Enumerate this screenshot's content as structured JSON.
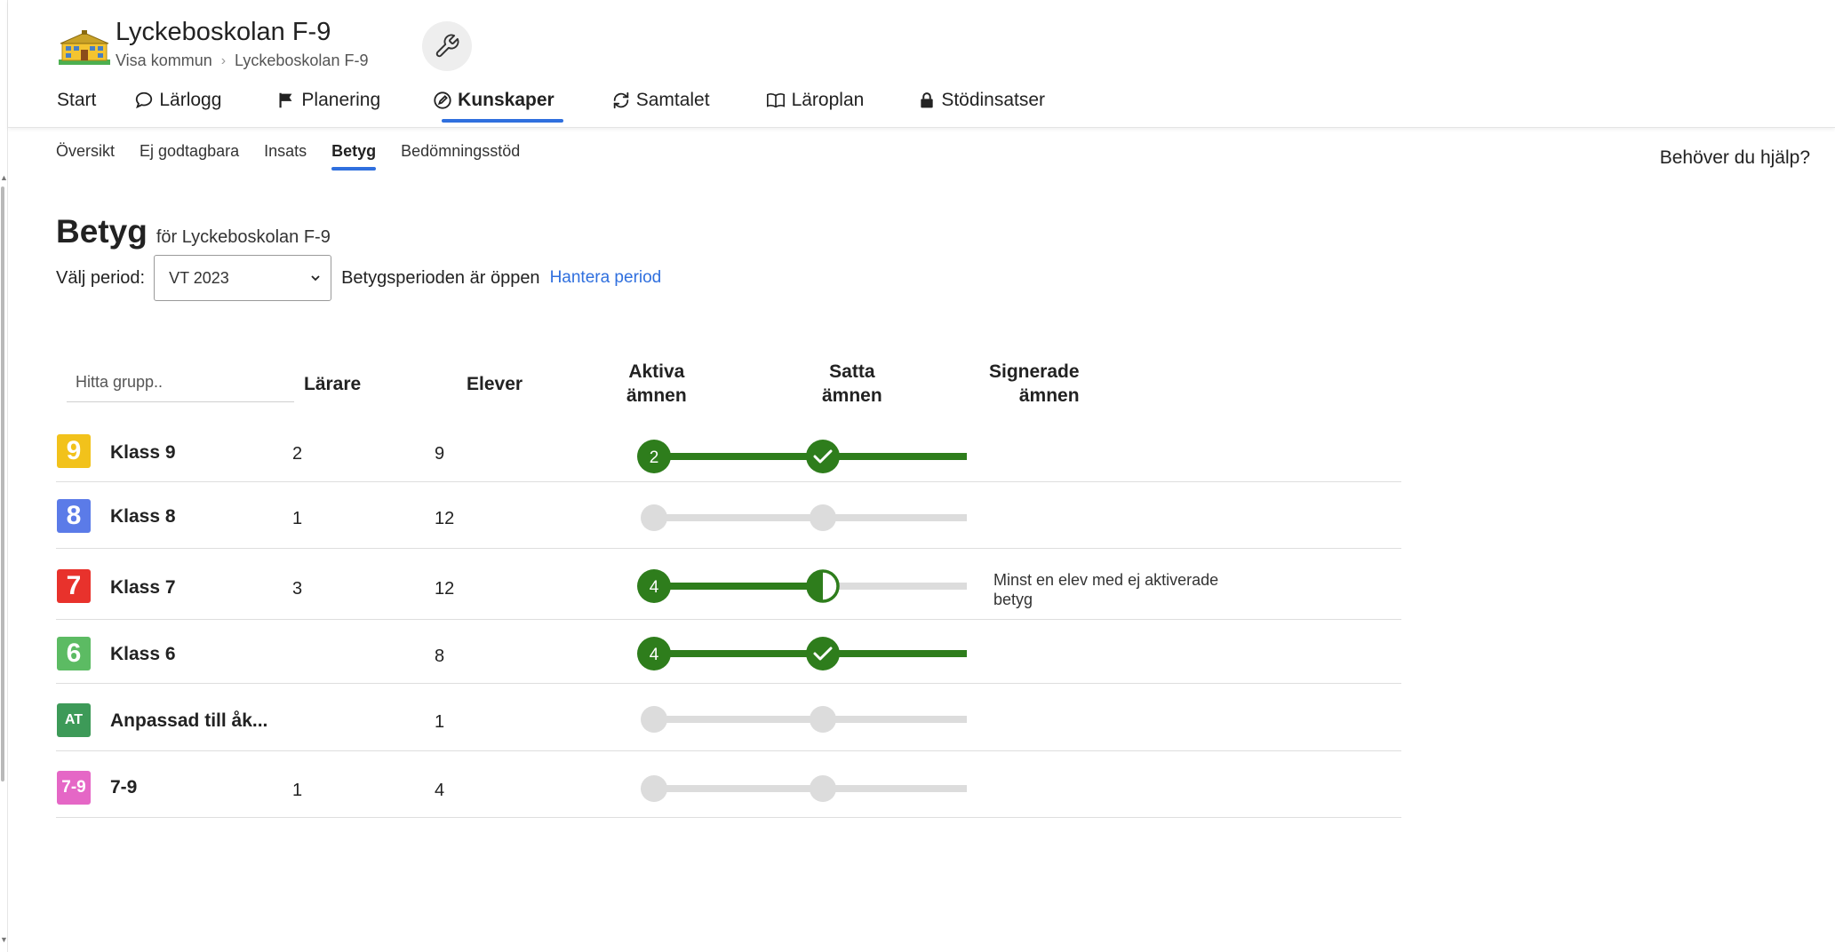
{
  "school": {
    "name": "Lyckeboskolan F-9",
    "breadcrumb": [
      "Visa kommun",
      "Lyckeboskolan F-9"
    ]
  },
  "main_nav": [
    {
      "label": "Start",
      "icon": "",
      "active": false
    },
    {
      "label": "Lärlogg",
      "icon": "speech-bubble-icon",
      "active": false
    },
    {
      "label": "Planering",
      "icon": "flag-icon",
      "active": false
    },
    {
      "label": "Kunskaper",
      "icon": "pencil-circle-icon",
      "active": true
    },
    {
      "label": "Samtalet",
      "icon": "refresh-icon",
      "active": false
    },
    {
      "label": "Läroplan",
      "icon": "open-book-icon",
      "active": false
    },
    {
      "label": "Stödinsatser",
      "icon": "lock-icon",
      "active": false
    }
  ],
  "sub_nav": [
    {
      "label": "Översikt",
      "active": false
    },
    {
      "label": "Ej godtagbara",
      "active": false
    },
    {
      "label": "Insats",
      "active": false
    },
    {
      "label": "Betyg",
      "active": true
    },
    {
      "label": "Bedömningsstöd",
      "active": false
    }
  ],
  "help_label": "Behöver du hjälp?",
  "page": {
    "title": "Betyg",
    "subtitle": "för Lyckeboskolan F-9",
    "period_label": "Välj period:",
    "period_value": "VT 2023",
    "period_status": "Betygsperioden är öppen",
    "manage_period": "Hantera period"
  },
  "table": {
    "search_placeholder": "Hitta grupp..",
    "columns": {
      "teachers": "Lärare",
      "students": "Elever",
      "active_1": "Aktiva",
      "active_2": "ämnen",
      "set_1": "Satta",
      "set_2": "ämnen",
      "signed_1": "Signerade",
      "signed_2": "ämnen"
    },
    "rows": [
      {
        "badge": "9",
        "badge_color": "#f2c21b",
        "name": "Klass 9",
        "teachers": "2",
        "students": "9",
        "active_count": "2",
        "active_state": "full",
        "set_state": "full",
        "signed_state": "full",
        "note": ""
      },
      {
        "badge": "8",
        "badge_color": "#5b7be8",
        "name": "Klass 8",
        "teachers": "1",
        "students": "12",
        "active_count": "",
        "active_state": "none",
        "set_state": "none",
        "signed_state": "none",
        "note": ""
      },
      {
        "badge": "7",
        "badge_color": "#e8322c",
        "name": "Klass 7",
        "teachers": "3",
        "students": "12",
        "active_count": "4",
        "active_state": "full",
        "set_state": "half",
        "signed_state": "quarter",
        "note": "Minst en elev med ej aktiverade betyg"
      },
      {
        "badge": "6",
        "badge_color": "#5cbb63",
        "name": "Klass 6",
        "teachers": "",
        "students": "8",
        "active_count": "4",
        "active_state": "full",
        "set_state": "full",
        "signed_state": "full",
        "note": ""
      },
      {
        "badge": "AT",
        "badge_color": "#3d9a58",
        "name": "Anpassad till åk...",
        "teachers": "",
        "students": "1",
        "active_count": "",
        "active_state": "none",
        "set_state": "none",
        "signed_state": "none",
        "note": ""
      },
      {
        "badge": "7-9",
        "badge_color": "#e567c6",
        "name": "7-9",
        "teachers": "1",
        "students": "4",
        "active_count": "",
        "active_state": "none",
        "set_state": "none",
        "signed_state": "none",
        "note": ""
      }
    ]
  },
  "colors": {
    "accent": "#2f6fde",
    "progress_green": "#2e7d1c",
    "progress_gray": "#dcdcdc"
  }
}
